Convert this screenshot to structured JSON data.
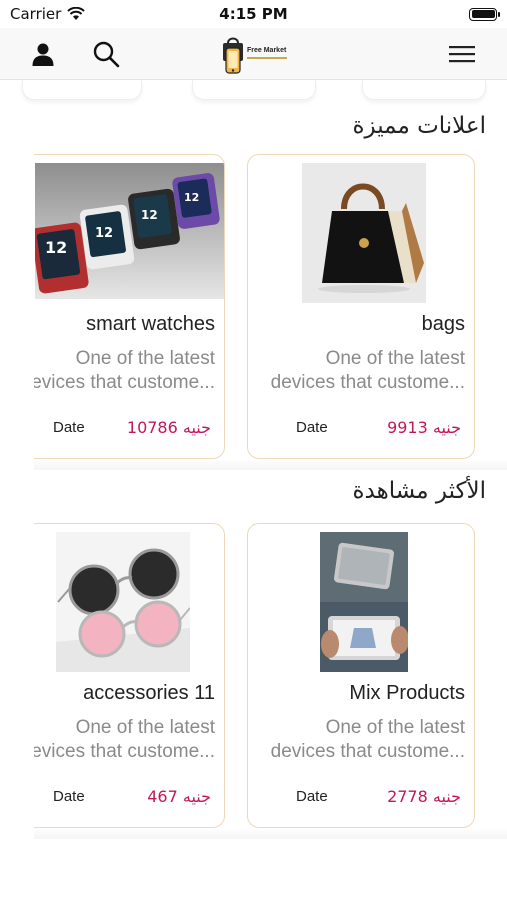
{
  "status_bar": {
    "carrier": "Carrier",
    "time": "4:15 PM"
  },
  "nav": {
    "logo_text": "Free Market",
    "icons": [
      "user-icon",
      "search-icon",
      "hamburger-menu-icon"
    ]
  },
  "sections": [
    {
      "title": "اعلانات مميزة",
      "cards": [
        {
          "name": "bags",
          "desc_line1": "One of the latest",
          "desc_line2": "devices that custome...",
          "price": "9913 جنيه",
          "date_label": "Date"
        },
        {
          "name": "smart watches",
          "desc_line1": "One of the latest",
          "desc_line2": "devices that custome...",
          "price": "10786 جنيه",
          "date_label": "Date"
        }
      ]
    },
    {
      "title": "الأكثر مشاهدة",
      "cards": [
        {
          "name": "Mix Products",
          "desc_line1": "One of the latest",
          "desc_line2": "devices that custome...",
          "price": "2778 جنيه",
          "date_label": "Date"
        },
        {
          "name": "accessories 11",
          "desc_line1": "One of the latest",
          "desc_line2": "devices that custome...",
          "price": "467 جنيه",
          "date_label": "Date"
        }
      ]
    }
  ]
}
